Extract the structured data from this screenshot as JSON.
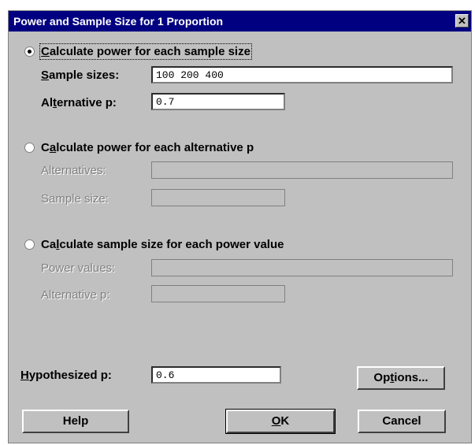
{
  "window": {
    "title": "Power and Sample Size for 1 Proportion",
    "close_glyph": "✕"
  },
  "options": [
    {
      "label": "Calculate power for each sample size",
      "accel_prefix": "",
      "accel": "C",
      "accel_suffix": "alculate power for each sample size",
      "selected": true,
      "fields": [
        {
          "label_prefix": "",
          "label_accel": "S",
          "label_suffix": "ample sizes:",
          "value": "100 200 400"
        },
        {
          "label_prefix": "Al",
          "label_accel": "t",
          "label_suffix": "ernative p:",
          "value": "0.7"
        }
      ]
    },
    {
      "label": "Calculate power for each alternative p",
      "accel_prefix": "C",
      "accel": "a",
      "accel_suffix": "lculate power for each alternative p",
      "selected": false,
      "fields": [
        {
          "label": "Alternatives:",
          "value": ""
        },
        {
          "label": "Sample size:",
          "value": ""
        }
      ]
    },
    {
      "label": "Calculate sample size for each power value",
      "accel_prefix": "Ca",
      "accel": "l",
      "accel_suffix": "culate sample size for each power value",
      "selected": false,
      "fields": [
        {
          "label": "Power values:",
          "value": ""
        },
        {
          "label": "Alternative p:",
          "value": ""
        }
      ]
    }
  ],
  "hypothesized": {
    "label_accel": "H",
    "label_suffix": "ypothesized p:",
    "value": "0.6"
  },
  "buttons": {
    "options": {
      "prefix": "Op",
      "accel": "t",
      "suffix": "ions..."
    },
    "help": "Help",
    "ok": {
      "accel": "O",
      "suffix": "K"
    },
    "cancel": "Cancel"
  },
  "icons": {
    "radio": "radio-button-icon",
    "close": "close-icon"
  }
}
